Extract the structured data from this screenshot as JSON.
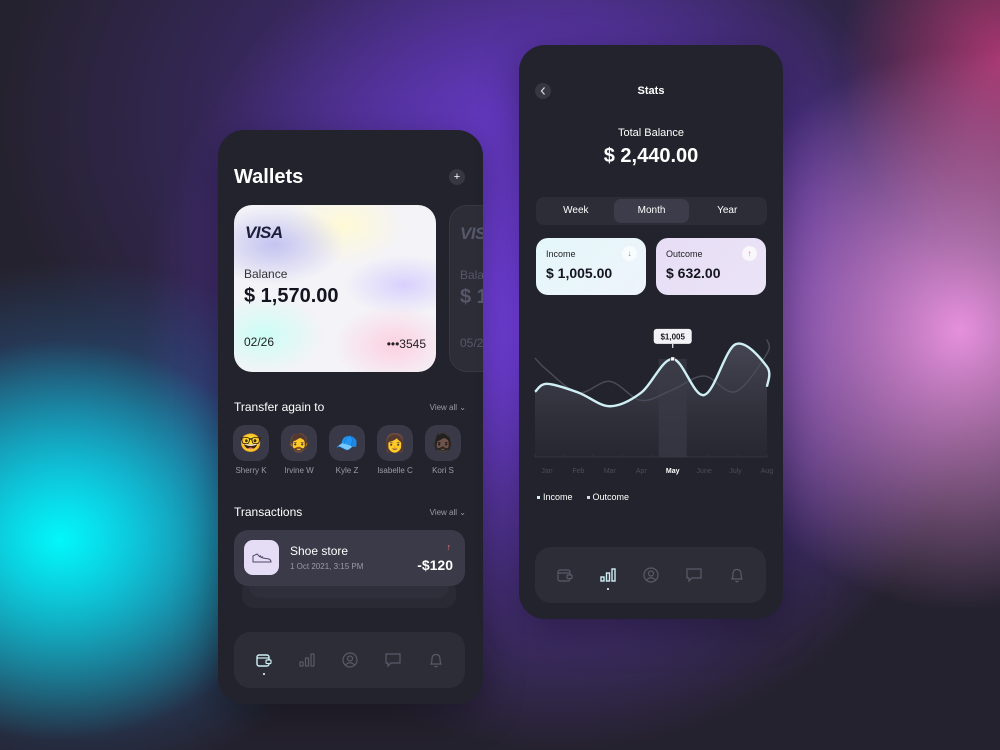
{
  "wallets_screen": {
    "title": "Wallets",
    "add_icon": "plus-icon",
    "cards": [
      {
        "brand": "VISA",
        "balance_label": "Balance",
        "balance": "$ 1,570.00",
        "expiry": "02/26",
        "number_masked": "•••3545"
      },
      {
        "brand": "VISA",
        "balance_label": "Balance",
        "balance": "$ 1",
        "expiry": "05/2"
      }
    ],
    "transfer_section": {
      "title": "Transfer again to",
      "view_all": "View all",
      "contacts": [
        {
          "name": "Sherry K",
          "avatar": "🤓"
        },
        {
          "name": "Irvine W",
          "avatar": "🧔"
        },
        {
          "name": "Kyle Z",
          "avatar": "🧢"
        },
        {
          "name": "Isabelle C",
          "avatar": "👩"
        },
        {
          "name": "Kori S",
          "avatar": "🧔🏿"
        }
      ]
    },
    "transactions_section": {
      "title": "Transactions",
      "view_all": "View all",
      "items": [
        {
          "name": "Shoe store",
          "date": "1 Oct 2021, 3:15 PM",
          "amount": "-$120",
          "direction": "out",
          "icon": "shoe-icon"
        }
      ]
    },
    "nav": {
      "items": [
        "wallet",
        "stats",
        "profile",
        "messages",
        "notifications"
      ],
      "active": "wallet"
    }
  },
  "stats_screen": {
    "title": "Stats",
    "total_balance_label": "Total Balance",
    "total_balance": "$ 2,440.00",
    "periods": [
      "Week",
      "Month",
      "Year"
    ],
    "active_period": "Month",
    "income": {
      "label": "Income",
      "amount": "$ 1,005.00",
      "arrow": "↓",
      "color": "#3bab5c"
    },
    "outcome": {
      "label": "Outcome",
      "amount": "$ 632.00",
      "arrow": "↑",
      "color": "#e86a6a"
    },
    "nav": {
      "items": [
        "wallet",
        "stats",
        "profile",
        "messages",
        "notifications"
      ],
      "active": "stats"
    }
  },
  "chart_data": {
    "type": "line",
    "title": "",
    "xlabel": "",
    "ylabel": "",
    "categories": [
      "Jan",
      "Feb",
      "Mar",
      "Apr",
      "May",
      "June",
      "July",
      "Aug"
    ],
    "highlighted_category": "May",
    "tooltip": {
      "category": "May",
      "series": "Income",
      "label": "$1,005"
    },
    "series": [
      {
        "name": "Income",
        "color": "#cfeff5",
        "values": [
          750,
          660,
          520,
          660,
          1005,
          635,
          1155,
          925
        ]
      },
      {
        "name": "Outcome",
        "color": "#4a4a58",
        "values": [
          890,
          660,
          775,
          580,
          690,
          830,
          670,
          1060
        ]
      }
    ],
    "ylim": [
      0,
      1250
    ],
    "grid": false,
    "legend": "bottom-left"
  }
}
